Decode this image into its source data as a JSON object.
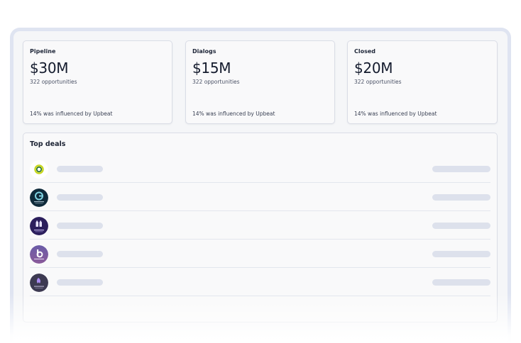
{
  "metrics": [
    {
      "label": "Pipeline",
      "value": "$30M",
      "sub": "322 opportunities",
      "foot": "14% was influenced by Upbeat"
    },
    {
      "label": "Dialogs",
      "value": "$15M",
      "sub": "322 opportunities",
      "foot": "14% was influenced by Upbeat"
    },
    {
      "label": "Closed",
      "value": "$20M",
      "sub": "322 opportunities",
      "foot": "14% was influenced by Upbeat"
    }
  ],
  "top_deals": {
    "title": "Top deals",
    "rows": [
      {
        "logo": "green-ring-logo-icon"
      },
      {
        "logo": "teal-g-logo-icon"
      },
      {
        "logo": "purple-blocks-logo-icon"
      },
      {
        "logo": "b-letter-logo-icon"
      },
      {
        "logo": "purple-flame-logo-icon"
      }
    ]
  },
  "colors": {
    "frame_border": "#dfe4f1",
    "card_bg": "#f9f9fa",
    "skeleton": "#dde1ec",
    "text": "#141b2d"
  }
}
